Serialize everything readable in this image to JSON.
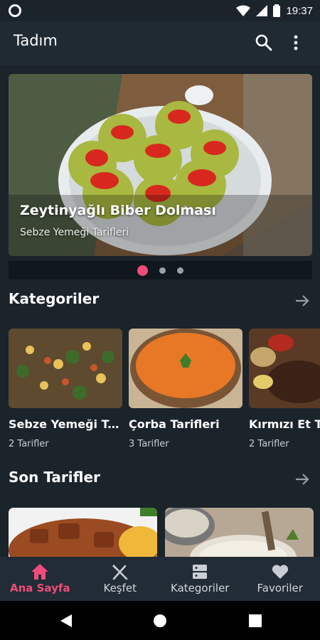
{
  "status_bar": {
    "time": "19:37"
  },
  "app_bar": {
    "title": "Tadım"
  },
  "hero": {
    "title": "Zeytinyağlı Biber Dolması",
    "subtitle": "Sebze Yemeği Tarifleri",
    "page_count": 3,
    "active_page": 1
  },
  "categories": {
    "title": "Kategoriler",
    "items": [
      {
        "title": "Sebze Yemeği Tarifleri",
        "count": "2 Tarifler"
      },
      {
        "title": "Çorba Tarifleri",
        "count": "3 Tarifler"
      },
      {
        "title": "Kırmızı Et Tarifleri",
        "count": "2 Tarifler"
      }
    ]
  },
  "recent": {
    "title": "Son Tarifler"
  },
  "bottom_nav": {
    "items": [
      {
        "label": "Ana Sayfa",
        "icon": "home-icon"
      },
      {
        "label": "Keşfet",
        "icon": "fork-knife-icon"
      },
      {
        "label": "Kategoriler",
        "icon": "category-list-icon"
      },
      {
        "label": "Favoriler",
        "icon": "heart-icon"
      }
    ]
  },
  "colors": {
    "accent": "#ef4c7b",
    "background": "#1b232b",
    "app_bar": "#1f2a33",
    "nav": "#212c36"
  }
}
